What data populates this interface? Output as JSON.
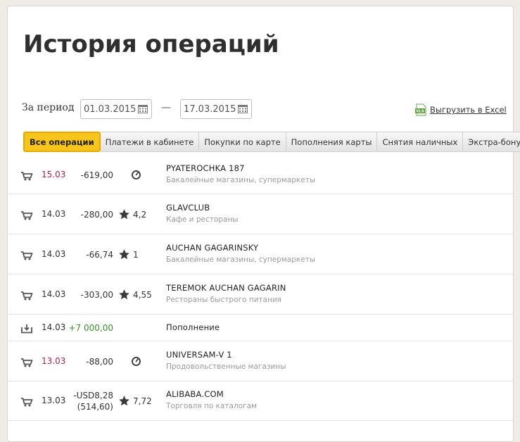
{
  "page": {
    "title": "История операций",
    "period_label": "За период",
    "date_from": "01.03.2015",
    "date_to": "17.03.2015",
    "dash": "—",
    "excel_link": "Выгрузить в Excel",
    "excel_badge": "XLS"
  },
  "tabs": [
    {
      "label": "Все операции",
      "active": true
    },
    {
      "label": "Платежи в кабинете",
      "active": false
    },
    {
      "label": "Покупки по карте",
      "active": false
    },
    {
      "label": "Пополнения карты",
      "active": false
    },
    {
      "label": "Снятия наличных",
      "active": false
    },
    {
      "label": "Экстра-бонусы",
      "active": false
    }
  ],
  "operations": [
    {
      "icon": "cart-icon",
      "date": "15.03",
      "date_color": "#a3224a",
      "amount": "-619,00",
      "amount_sub": "",
      "bonus_icon": "pending-clock-icon",
      "bonus": "",
      "name": "PYATEROCHKA 187",
      "category": "Бакалейные магазины, супермаркеты"
    },
    {
      "icon": "cart-icon",
      "date": "14.03",
      "date_color": "#333333",
      "amount": "-280,00",
      "amount_sub": "",
      "bonus_icon": "star-icon",
      "bonus": "4,2",
      "name": "GLAVCLUB",
      "category": "Кафе и рестораны"
    },
    {
      "icon": "cart-icon",
      "date": "14.03",
      "date_color": "#333333",
      "amount": "-66,74",
      "amount_sub": "",
      "bonus_icon": "star-icon",
      "bonus": "1",
      "name": "AUCHAN GAGARINSKY",
      "category": "Бакалейные магазины, супермаркеты"
    },
    {
      "icon": "cart-icon",
      "date": "14.03",
      "date_color": "#333333",
      "amount": "-303,00",
      "amount_sub": "",
      "bonus_icon": "star-icon",
      "bonus": "4,55",
      "name": "TEREMOK AUCHAN GAGARIN",
      "category": "Рестораны быстрого питания"
    },
    {
      "icon": "top-up-icon",
      "date": "14.03",
      "date_color": "#333333",
      "amount": "+7 000,00",
      "amount_sub": "",
      "bonus_icon": "",
      "bonus": "",
      "name": "Пополнение",
      "category": ""
    },
    {
      "icon": "cart-icon",
      "date": "13.03",
      "date_color": "#a3224a",
      "amount": "-88,00",
      "amount_sub": "",
      "bonus_icon": "pending-clock-icon",
      "bonus": "",
      "name": "UNIVERSAM-V 1",
      "category": "Продовольственные магазины"
    },
    {
      "icon": "cart-icon",
      "date": "13.03",
      "date_color": "#333333",
      "amount": "-USD8,28",
      "amount_sub": "(514,60)",
      "bonus_icon": "star-icon",
      "bonus": "7,72",
      "name": "ALIBABA.COM",
      "category": "Торговля по каталогам"
    }
  ],
  "colors": {
    "accent_tab": "#f8c51c",
    "positive_amount": "#3c8f2c",
    "pending_date": "#a3224a"
  }
}
